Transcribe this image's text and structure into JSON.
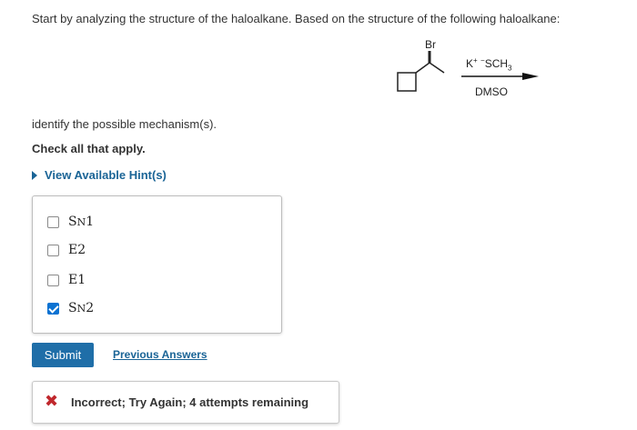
{
  "question": {
    "intro": "Start by analyzing the structure of the haloalkane. Based on the structure of the following haloalkane:",
    "reaction": {
      "leaving_group_label": "Br",
      "reagent_cation": "K",
      "reagent_cation_charge": "+",
      "reagent_anion_charge": "−",
      "reagent_anion": "SCH",
      "reagent_anion_subscript": "3",
      "solvent": "DMSO"
    },
    "prompt": "identify the possible mechanism(s).",
    "instruction": "Check all that apply."
  },
  "hint": {
    "label": "View Available Hint(s)"
  },
  "options": [
    {
      "label_main": "S",
      "label_sub": "N",
      "label_num": "1",
      "checked": false
    },
    {
      "label_main": "E2",
      "label_sub": "",
      "label_num": "",
      "checked": false
    },
    {
      "label_main": "E1",
      "label_sub": "",
      "label_num": "",
      "checked": false
    },
    {
      "label_main": "S",
      "label_sub": "N",
      "label_num": "2",
      "checked": true
    }
  ],
  "actions": {
    "submit_label": "Submit",
    "previous_answers_label": "Previous Answers"
  },
  "feedback": {
    "icon": "x-mark-icon",
    "message": "Incorrect; Try Again; 4 attempts remaining",
    "color": "#c0282d"
  },
  "colors": {
    "link": "#1a6496",
    "button": "#1f6ea8",
    "checkbox_checked": "#0b72d2"
  }
}
